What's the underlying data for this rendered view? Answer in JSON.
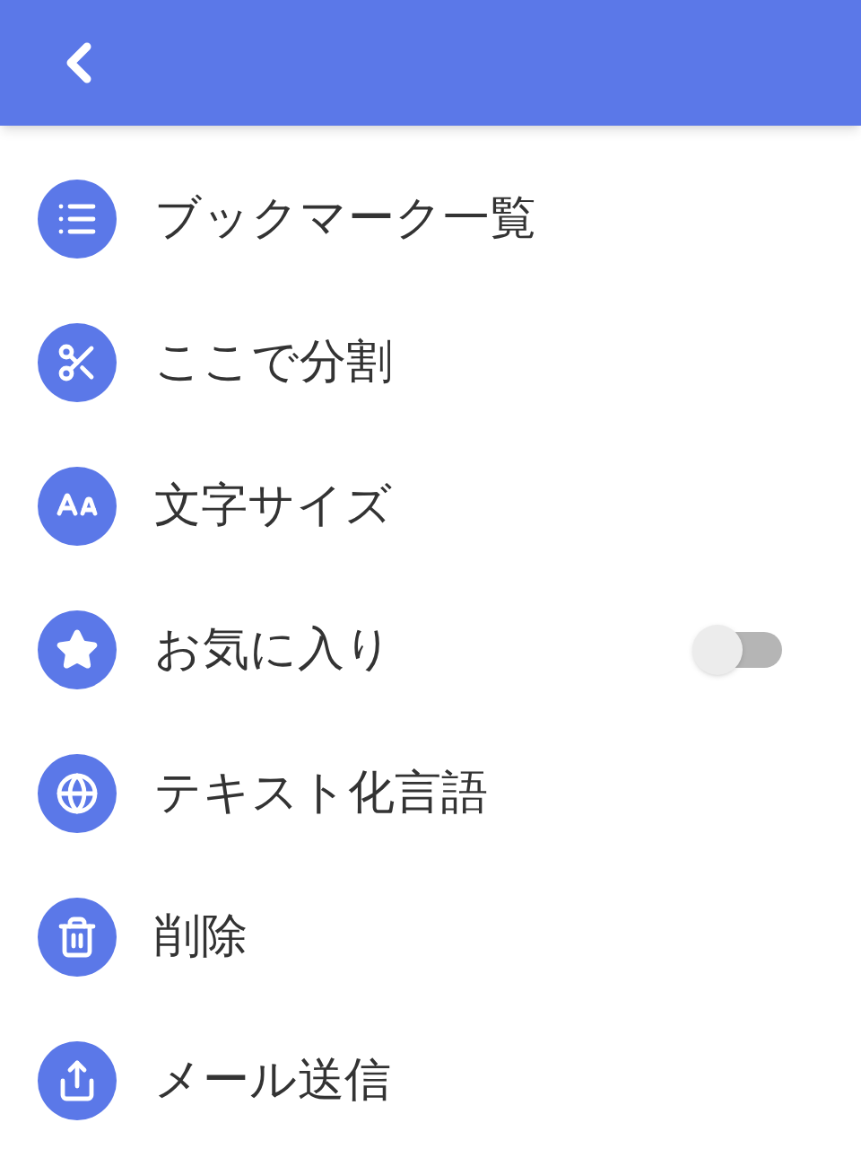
{
  "items": [
    {
      "label": "ブックマーク一覧",
      "kind": "plain"
    },
    {
      "label": "ここで分割",
      "kind": "plain"
    },
    {
      "label": "文字サイズ",
      "kind": "plain"
    },
    {
      "label": "お気に入り",
      "kind": "toggle",
      "on": false
    },
    {
      "label": "テキスト化言語",
      "kind": "plain"
    },
    {
      "label": "削除",
      "kind": "plain"
    },
    {
      "label": "メール送信",
      "kind": "plain"
    }
  ]
}
